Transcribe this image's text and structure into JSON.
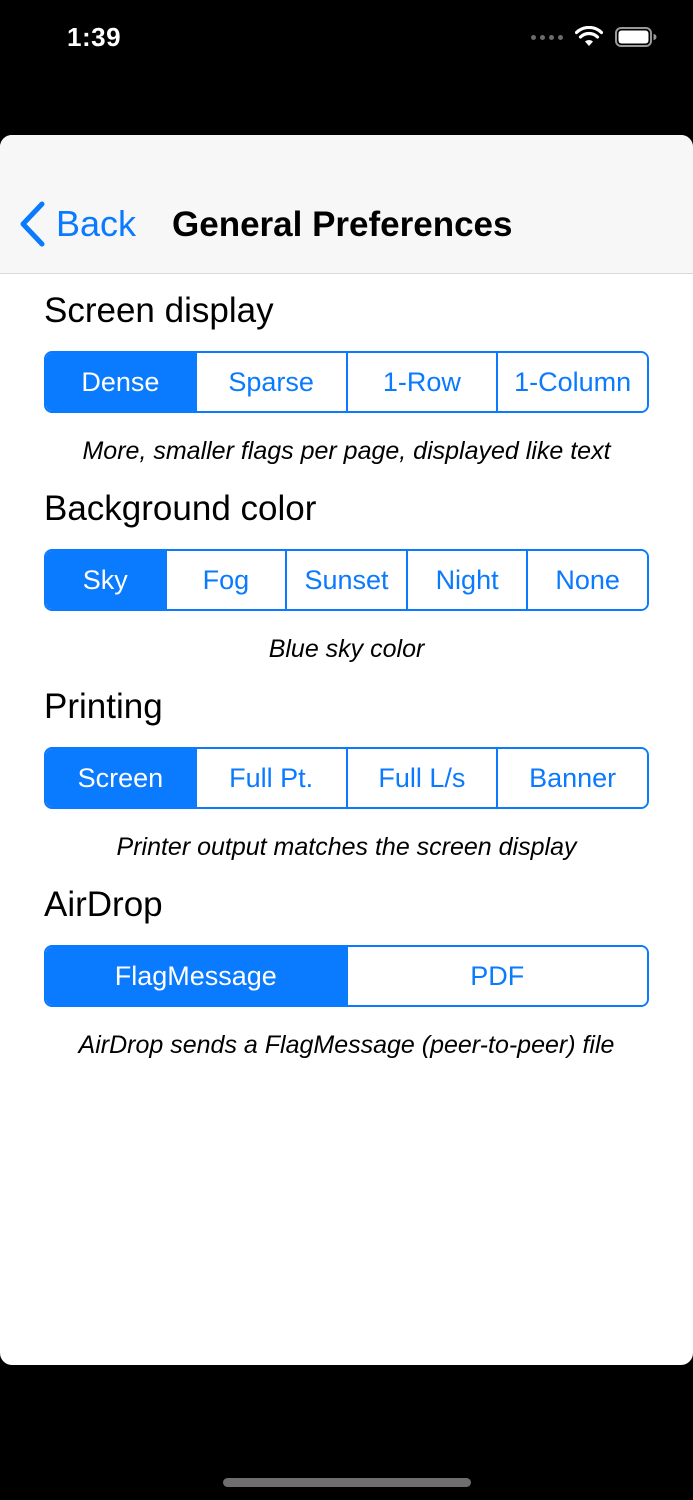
{
  "status_bar": {
    "time": "1:39"
  },
  "nav": {
    "back_label": "Back",
    "title": "General Preferences"
  },
  "sections": [
    {
      "title": "Screen display",
      "options": [
        "Dense",
        "Sparse",
        "1-Row",
        "1-Column"
      ],
      "selected": "Dense",
      "caption": "More, smaller flags per page, displayed like text"
    },
    {
      "title": "Background color",
      "options": [
        "Sky",
        "Fog",
        "Sunset",
        "Night",
        "None"
      ],
      "selected": "Sky",
      "caption": "Blue sky color"
    },
    {
      "title": "Printing",
      "options": [
        "Screen",
        "Full Pt.",
        "Full L/s",
        "Banner"
      ],
      "selected": "Screen",
      "caption": "Printer output matches the screen display"
    },
    {
      "title": "AirDrop",
      "options": [
        "FlagMessage",
        "PDF"
      ],
      "selected": "FlagMessage",
      "caption": "AirDrop sends a FlagMessage (peer-to-peer) file"
    }
  ],
  "colors": {
    "accent": "#0a7aff",
    "nav_background": "#f7f7f7",
    "background": "#ffffff",
    "frame": "#000000"
  },
  "icons": {
    "back": "chevron-left-icon",
    "signal": "cellular-signal-icon",
    "wifi": "wifi-icon",
    "battery": "battery-icon"
  }
}
